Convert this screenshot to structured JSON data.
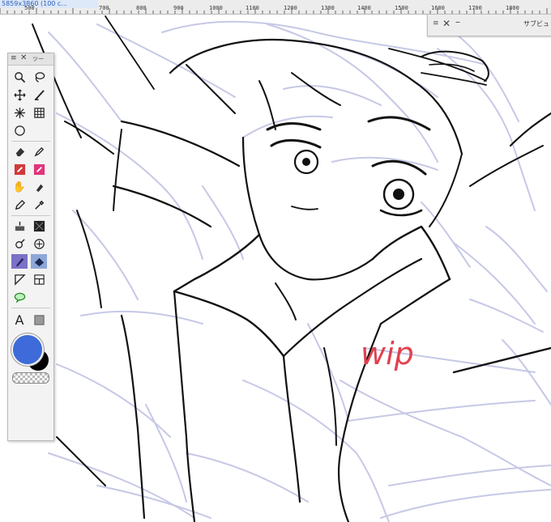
{
  "ruler": {
    "file_label": "5859x3860 (100 c...",
    "ticks": [
      "500",
      "700",
      "800",
      "900",
      "1000",
      "1100",
      "1200",
      "1300",
      "1400",
      "1500",
      "1600",
      "1700",
      "1800"
    ]
  },
  "toolbox": {
    "title": "ツー"
  },
  "subpanel": {
    "title": "サブビュ"
  },
  "annotation": {
    "text": "wip",
    "color": "#e0414f"
  },
  "colors": {
    "main": "#3e6bd9",
    "sub": "#000000",
    "sketch": "#c6c8e6",
    "ink": "#111111"
  }
}
